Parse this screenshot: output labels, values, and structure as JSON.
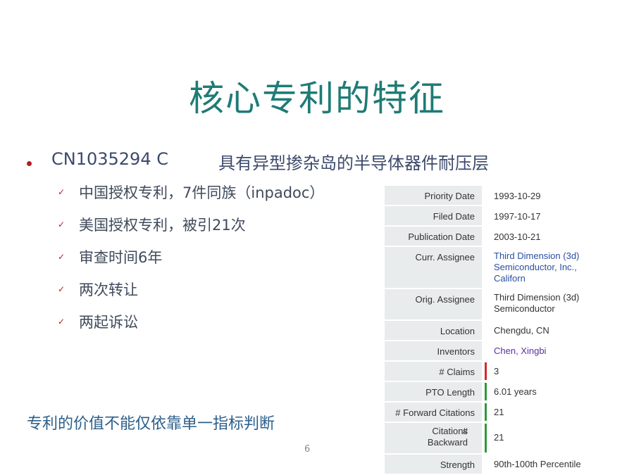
{
  "slide": {
    "title": "核心专利的特征",
    "main_bullet": {
      "code": "CN1035294 C",
      "description": "具有异型掺杂岛的半导体器件耐压层"
    },
    "sub_bullets": [
      "中国授权专利，7件同族（inpadoc）",
      "美国授权专利，被引21次",
      "审查时间6年",
      "两次转让",
      "两起诉讼"
    ],
    "summary": "专利的价值不能仅依靠单一指标判断",
    "page_number": "6",
    "colors": {
      "title": "#1f7b76",
      "bullet_dot": "#b22020",
      "summary": "#2c5f8a",
      "bar_red": "#d42a2a",
      "bar_green": "#2d9a3a"
    }
  },
  "patent_info": [
    {
      "label": "Priority Date",
      "value": "1993-10-29"
    },
    {
      "label": "Filed Date",
      "value": "1997-10-17"
    },
    {
      "label": "Publication Date",
      "value": "2003-10-21"
    },
    {
      "label": "Curr. Assignee",
      "value_lines": [
        "Third Dimension (3d)",
        "Semiconductor, Inc.,",
        "Californ"
      ],
      "style": "link"
    },
    {
      "label": "Orig. Assignee",
      "value_lines": [
        "Third Dimension (3d)",
        "Semiconductor"
      ]
    },
    {
      "label": "Location",
      "value": "Chengdu, CN"
    },
    {
      "label": "Inventors",
      "value": "Chen, Xingbi",
      "style": "purple"
    },
    {
      "label": "# Claims",
      "value": "3",
      "bar": "red"
    },
    {
      "label": "PTO Length",
      "value": "6.01 years",
      "bar": "green"
    },
    {
      "label": "# Forward Citations",
      "value": "21",
      "bar": "green"
    },
    {
      "label_lines": [
        "# Backward",
        "Citations"
      ],
      "value": "21",
      "bar": "green"
    },
    {
      "label": "Strength",
      "value": "90th-100th Percentile"
    }
  ]
}
